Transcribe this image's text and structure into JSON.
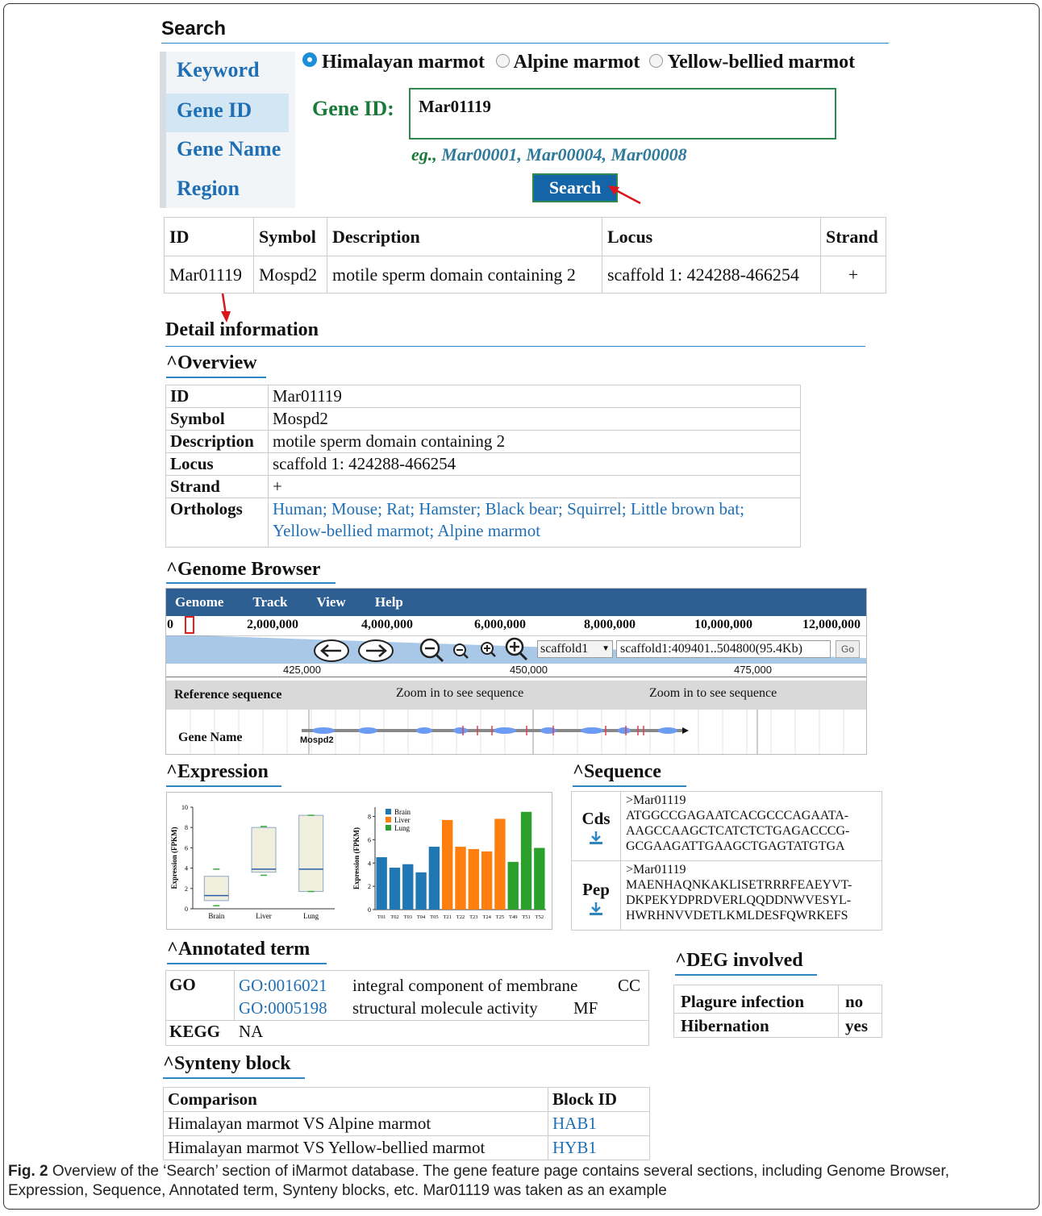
{
  "search": {
    "title": "Search",
    "nav": [
      "Keyword",
      "Gene ID",
      "Gene Name",
      "Region"
    ],
    "species": [
      "Himalayan marmot",
      "Alpine marmot",
      "Yellow-bellied marmot"
    ],
    "field_label": "Gene ID:",
    "field_value": "Mar01119",
    "example": "eg., Mar00001, Mar00004, Mar00008",
    "button": "Search"
  },
  "results": {
    "headers": [
      "ID",
      "Symbol",
      "Description",
      "Locus",
      "Strand"
    ],
    "row": [
      "Mar01119",
      "Mospd2",
      "motile sperm domain containing 2",
      "scaffold 1: 424288-466254",
      "+"
    ]
  },
  "detail": {
    "title": "Detail information",
    "overview": {
      "title": "^Overview",
      "rows": [
        {
          "k": "ID",
          "v": "Mar01119"
        },
        {
          "k": "Symbol",
          "v": "Mospd2"
        },
        {
          "k": "Description",
          "v": "motile sperm domain containing 2"
        },
        {
          "k": "Locus",
          "v": "scaffold 1: 424288-466254"
        },
        {
          "k": "Strand",
          "v": "+"
        }
      ],
      "orthologs_label": "Orthologs",
      "orthologs_line1": "Human; Mouse; Rat; Hamster; Black bear; Squirrel; Little brown bat;",
      "orthologs_line2": "Yellow-bellied marmot; Alpine marmot"
    },
    "genome_browser": {
      "title": "^Genome Browser",
      "menu": [
        "Genome",
        "Track",
        "View",
        "Help"
      ],
      "ruler": [
        "0",
        "2,000,000",
        "4,000,000",
        "6,000,000",
        "8,000,000",
        "10,000,000",
        "12,000,000"
      ],
      "scaffold_select": "scaffold1",
      "location": "scaffold1:409401..504800(95.4Kb)",
      "go": "Go",
      "detail_ruler": [
        "425,000",
        "450,000",
        "475,000"
      ],
      "ref_label": "Reference sequence",
      "zoom_msg": "Zoom in to see sequence",
      "gene_track_label": "Gene Name",
      "gene_name": "Mospd2"
    },
    "expression": {
      "title": "^Expression"
    },
    "sequence": {
      "title": "^Sequence",
      "cds_label": "Cds",
      "cds": [
        ">Mar01119",
        "ATGGCCGAGAATCACGCCCAGAATA-",
        "AAGCCAAGCTCATCTCTGAGACCCG-",
        "GCGAAGATTGAAGCTGAGTATGTGA"
      ],
      "pep_label": "Pep",
      "pep": [
        ">Mar01119",
        "MAENHAQNKAKLISETRRRFEAEYVT-",
        "DKPEKYDPRDVERLQQDDNWVESYL-",
        "HWRHNVVDETLKMLDESFQWRKEFS"
      ]
    },
    "annotated": {
      "title": "^Annotated term",
      "go_label": "GO",
      "go_terms": [
        {
          "id": "GO:0016021",
          "desc": "integral component of membrane",
          "cat": "CC"
        },
        {
          "id": "GO:0005198",
          "desc": "structural molecule activity",
          "cat": "MF"
        }
      ],
      "kegg_label": "KEGG",
      "kegg_value": "NA"
    },
    "deg": {
      "title": "^DEG involved",
      "rows": [
        {
          "k": "Plagure infection",
          "v": "no"
        },
        {
          "k": "Hibernation",
          "v": "yes"
        }
      ]
    },
    "synteny": {
      "title": "^Synteny block",
      "headers": [
        "Comparison",
        "Block ID"
      ],
      "rows": [
        {
          "c": "Himalayan marmot VS Alpine marmot",
          "b": "HAB1"
        },
        {
          "c": "Himalayan marmot VS Yellow-bellied marmot",
          "b": "HYB1"
        }
      ]
    }
  },
  "chart_data": [
    {
      "type": "box",
      "ylabel": "Expression (FPKM)",
      "categories": [
        "Brain",
        "Liver",
        "Lung"
      ],
      "ylim": [
        0,
        10
      ],
      "yticks": [
        "0",
        "2",
        "4",
        "6",
        "8",
        "10"
      ],
      "boxes": [
        {
          "q1": 0.8,
          "median": 1.3,
          "q3": 3.2,
          "min": 0.3,
          "max": 3.9
        },
        {
          "q1": 3.6,
          "median": 3.9,
          "q3": 8.0,
          "min": 3.3,
          "max": 8.1
        },
        {
          "q1": 1.7,
          "median": 3.9,
          "q3": 9.2,
          "min": 1.7,
          "max": 9.2
        }
      ]
    },
    {
      "type": "bar",
      "ylabel": "Expression (FPKM)",
      "ylim": [
        0,
        8.8
      ],
      "yticks": [
        "0",
        "2",
        "4",
        "6",
        "8"
      ],
      "categories": [
        "T01",
        "T02",
        "T03",
        "T04",
        "T05",
        "T21",
        "T22",
        "T23",
        "T24",
        "T25",
        "T49",
        "T51",
        "T52"
      ],
      "series": [
        {
          "name": "Brain",
          "color": "#1f77b4",
          "values": [
            4.5,
            3.6,
            3.9,
            3.2,
            5.4,
            null,
            null,
            null,
            null,
            null,
            null,
            null,
            null
          ]
        },
        {
          "name": "Liver",
          "color": "#ff7f0e",
          "values": [
            null,
            null,
            null,
            null,
            null,
            7.7,
            5.4,
            5.2,
            5.0,
            7.8,
            null,
            null,
            null
          ]
        },
        {
          "name": "Lung",
          "color": "#2ca02c",
          "values": [
            null,
            null,
            null,
            null,
            null,
            null,
            null,
            null,
            null,
            null,
            4.1,
            8.4,
            5.3
          ]
        }
      ]
    }
  ],
  "caption": {
    "label": "Fig. 2",
    "text": " Overview of the ‘Search’ section of iMarmot database. The gene feature page contains several sections, including Genome Browser, Expression, Sequence, Annotated term, Synteny blocks, etc. Mar01119 was taken as an example"
  },
  "colors": {
    "accent": "#2f86c4",
    "link": "#1f6fb5",
    "menu_bar": "#2e5f92",
    "button": "#1464a8",
    "green_label": "#1a7a3a"
  }
}
